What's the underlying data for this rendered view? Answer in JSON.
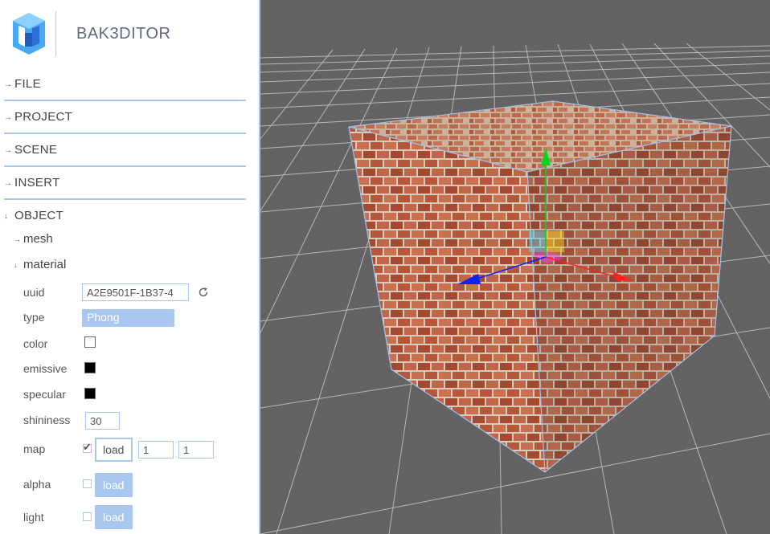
{
  "app": {
    "brand": "BAK3DITOR"
  },
  "sidebar": {
    "sections": [
      {
        "label": "FILE",
        "arrow": "→"
      },
      {
        "label": "PROJECT",
        "arrow": "→"
      },
      {
        "label": "SCENE",
        "arrow": "→"
      },
      {
        "label": "INSERT",
        "arrow": "→"
      },
      {
        "label": "OBJECT",
        "arrow": "↓"
      }
    ],
    "object": {
      "mesh": {
        "label": "mesh",
        "arrow": "→"
      },
      "material": {
        "label": "material",
        "arrow": "↓"
      }
    },
    "material": {
      "uuid": {
        "label": "uuid",
        "value": "A2E9501F-1B37-4",
        "refresh_icon": "refresh-icon"
      },
      "type": {
        "label": "type",
        "value": "Phong"
      },
      "color": {
        "label": "color",
        "value": "#ffffff"
      },
      "emissive": {
        "label": "emissive",
        "value": "#000000"
      },
      "specular": {
        "label": "specular",
        "value": "#000000"
      },
      "shininess": {
        "label": "shininess",
        "value": "30"
      },
      "map": {
        "label": "map",
        "enabled": true,
        "load_label": "load",
        "repeat_x": "1",
        "repeat_y": "1"
      },
      "alpha": {
        "label": "alpha",
        "enabled": false,
        "load_label": "load"
      },
      "light": {
        "label": "light",
        "enabled": false,
        "load_label": "load"
      }
    }
  },
  "viewport": {
    "background": "#646262",
    "grid_color": "#b8b8b8",
    "selection_color": "#9ec3f0",
    "gizmo": {
      "x_color": "#ff2020",
      "y_color": "#10d020",
      "z_color": "#1020ff"
    },
    "object_texture": "brick"
  },
  "colors": {
    "accent": "#a9c6ee"
  }
}
